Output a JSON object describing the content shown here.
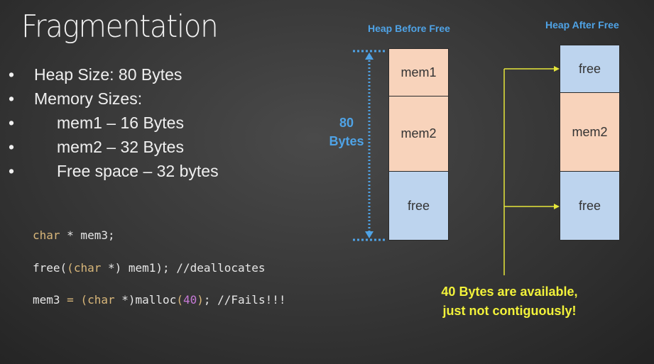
{
  "title": "Fragmentation",
  "bullets": {
    "heap_size": "Heap Size: 80 Bytes",
    "memory_sizes": "Memory Sizes:",
    "sub": [
      "mem1 – 16 Bytes",
      "mem2 – 32 Bytes",
      "Free space – 32 bytes"
    ]
  },
  "code": {
    "line1": {
      "kw": "char",
      "rest": " * mem3;"
    },
    "line2": {
      "fn": "free(",
      "paren": "(",
      "kw": "char",
      "rest": " *) mem1); //deallocates"
    },
    "line3": {
      "pre": "mem3 ",
      "eq": "=",
      "sp": " ",
      "paren": "(",
      "kw": "char",
      "rest1": " *)malloc",
      "open": "(",
      "num": "40",
      "close": ")",
      "rest2": "; //Fails!!!"
    }
  },
  "heap_before": {
    "title": "Heap Before Free",
    "blocks": [
      "mem1",
      "mem2",
      "free"
    ]
  },
  "heap_after": {
    "title": "Heap After Free",
    "blocks": [
      "free",
      "mem2",
      "free"
    ]
  },
  "size_label": {
    "line1": "80",
    "line2": "Bytes"
  },
  "note": {
    "line1": "40 Bytes are available,",
    "line2": "just not contiguously!"
  },
  "colors": {
    "mem_block": "#f8d3bb",
    "free_block": "#bdd4ee",
    "accent_blue": "#4fa3e6",
    "arrow_yellow": "#e6e63a"
  }
}
